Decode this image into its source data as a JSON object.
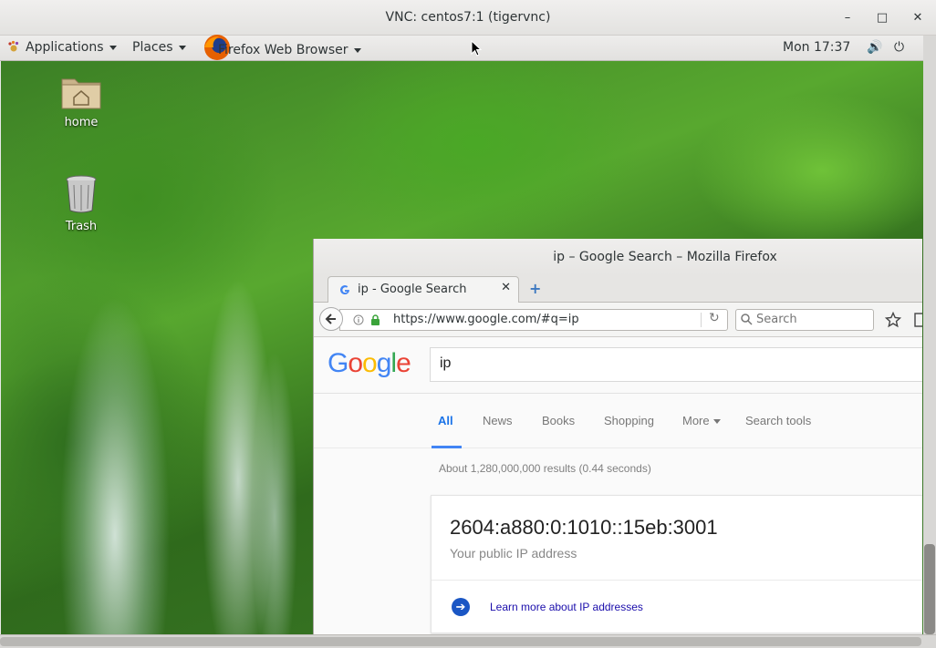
{
  "vnc": {
    "title": "VNC: centos7:1 (tigervnc)",
    "minimize": "–",
    "maximize": "□",
    "close": "✕"
  },
  "topbar": {
    "applications": "Applications",
    "places": "Places",
    "app": "Firefox Web Browser",
    "clock": "Mon 17:37",
    "volume": "🔊",
    "power": "⏻"
  },
  "desktop": {
    "icons": [
      {
        "label": "home"
      },
      {
        "label": "Trash"
      }
    ]
  },
  "firefox": {
    "title": "ip – Google Search – Mozilla Firefox",
    "tab": {
      "label": "ip - Google Search",
      "close": "✕",
      "favicon": "G"
    },
    "new_tab": "+",
    "url": "https://www.google.com/#q=ip",
    "search_placeholder": "Search",
    "reload": "↻"
  },
  "google": {
    "query": "ip",
    "tabs": [
      "All",
      "News",
      "Books",
      "Shopping",
      "More",
      "Search tools"
    ],
    "stats": "About 1,280,000,000 results (0.44 seconds)",
    "ip_address": "2604:a880:0:1010::15eb:3001",
    "ip_subtitle": "Your public IP address",
    "learn_more": "Learn more about IP addresses"
  },
  "colors": {
    "google_blue": "#4285f4",
    "google_red": "#ea4335",
    "google_yellow": "#fbbc05",
    "google_green": "#34a853",
    "link": "#1a0dab"
  }
}
